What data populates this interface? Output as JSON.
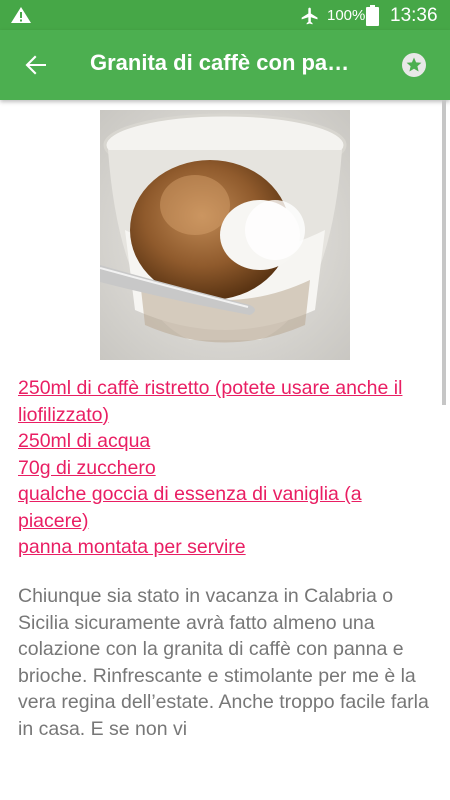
{
  "status_bar": {
    "battery_percent": "100%",
    "time": "13:36",
    "icons": [
      "warning-icon",
      "airplane-mode-icon",
      "battery-icon"
    ]
  },
  "app_bar": {
    "title": "Granita di caffè con pa…",
    "icons": [
      "arrow-back-icon",
      "star-icon"
    ],
    "color": "#4caf50",
    "status_color": "#46a747"
  },
  "recipe": {
    "ingredients": [
      "250ml di caffè ristretto (potete usare anche il liofilizzato)",
      "250ml di acqua",
      "70g di zucchero",
      "qualche goccia di essenza di vaniglia (a piacere)",
      "panna montata per servire"
    ],
    "description": "Chiunque sia stato in vacanza in Calabria o Sicilia sicuramente avrà fatto almeno una colazione con la granita di caffè con panna e brioche. Rinfrescante e stimolante per me è la vera regina dell’estate. Anche troppo facile farla in casa. E se non vi",
    "link_color": "#e91e63",
    "text_color": "#777777"
  }
}
